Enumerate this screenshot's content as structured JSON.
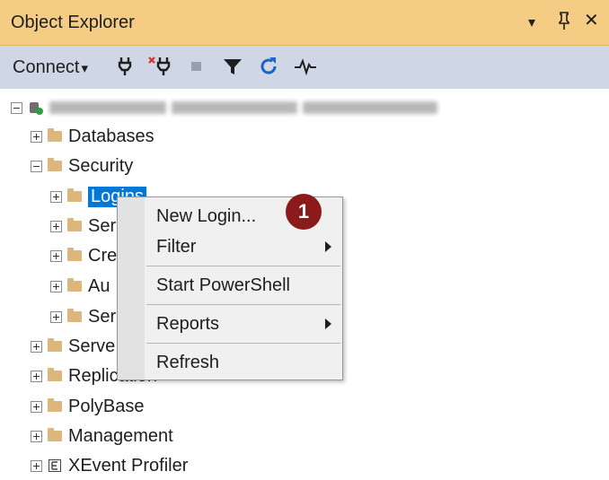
{
  "panel": {
    "title": "Object Explorer",
    "controls": {
      "dropdown": "▾",
      "pin": "ᛘ",
      "close": "✕"
    }
  },
  "toolbar": {
    "connect_label": "Connect",
    "connect_arrow": "▾",
    "icons": [
      "connect-plug-icon",
      "disconnect-plug-icon",
      "stop-icon",
      "filter-icon",
      "refresh-icon",
      "activity-monitor-icon"
    ]
  },
  "tree": {
    "server_label": "",
    "nodes": [
      {
        "label": "Databases",
        "expanded": false
      },
      {
        "label": "Security",
        "expanded": true
      },
      {
        "label": "Logins",
        "expanded": false,
        "selected": true
      },
      {
        "label": "Ser",
        "expanded": false
      },
      {
        "label": "Cre",
        "expanded": false
      },
      {
        "label": "Au",
        "expanded": false
      },
      {
        "label": "Ser",
        "expanded": false
      },
      {
        "label": "Serve",
        "expanded": false
      },
      {
        "label": "Replication",
        "expanded": false
      },
      {
        "label": "PolyBase",
        "expanded": false
      },
      {
        "label": "Management",
        "expanded": false
      },
      {
        "label": "XEvent Profiler",
        "expanded": false
      }
    ]
  },
  "context_menu": {
    "items": [
      {
        "label": "New Login...",
        "submenu": false
      },
      {
        "label": "Filter",
        "submenu": true
      },
      {
        "label": "Start PowerShell",
        "submenu": false
      },
      {
        "label": "Reports",
        "submenu": true
      },
      {
        "label": "Refresh",
        "submenu": false
      }
    ]
  },
  "callout": {
    "number": "1",
    "color": "#8b1a1a"
  },
  "colors": {
    "title_bar": "#f5cc84",
    "toolbar": "#cfd6e5",
    "selection": "#0078d7",
    "folder": "#dcb67a"
  }
}
